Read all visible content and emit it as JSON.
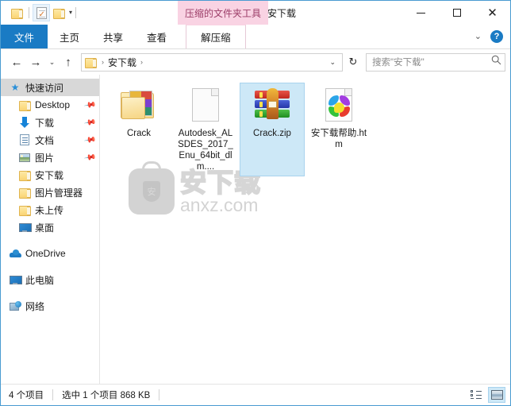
{
  "window": {
    "title": "安下载",
    "contextual_tab": "压缩的文件夹工具",
    "controls": {
      "minimize": "minimize-icon",
      "maximize": "maximize-icon",
      "close": "✕"
    }
  },
  "quick_access_toolbar": {
    "items": [
      {
        "name": "folder-properties-icon"
      },
      {
        "name": "document-check-icon"
      },
      {
        "name": "new-folder-icon"
      }
    ],
    "customize_caret": "▾"
  },
  "ribbon": {
    "tabs": [
      {
        "label": "文件",
        "selected": true
      },
      {
        "label": "主页",
        "selected": false
      },
      {
        "label": "共享",
        "selected": false
      },
      {
        "label": "查看",
        "selected": false
      }
    ],
    "contextual_tab": {
      "label": "解压缩"
    },
    "collapse_caret": "⌄",
    "help_label": "?"
  },
  "navbar": {
    "back": "←",
    "forward": "→",
    "recent_caret": "⌄",
    "up": "↑",
    "breadcrumb": {
      "root_icon": "folder-icon",
      "path": "安下载",
      "separator": "›"
    },
    "history_caret": "⌄",
    "refresh": "↻",
    "search": {
      "placeholder": "搜索\"安下载\"",
      "icon": "search-icon"
    }
  },
  "sidebar": {
    "items": [
      {
        "label": "快速访问",
        "icon": "star-icon",
        "selected": true,
        "pinned": false,
        "indent": 0
      },
      {
        "label": "Desktop",
        "icon": "folder-icon",
        "selected": false,
        "pinned": true,
        "indent": 1
      },
      {
        "label": "下载",
        "icon": "download-icon",
        "selected": false,
        "pinned": true,
        "indent": 1
      },
      {
        "label": "文档",
        "icon": "document-icon",
        "selected": false,
        "pinned": true,
        "indent": 1
      },
      {
        "label": "图片",
        "icon": "pictures-icon",
        "selected": false,
        "pinned": true,
        "indent": 1
      },
      {
        "label": "安下载",
        "icon": "folder-icon",
        "selected": false,
        "pinned": false,
        "indent": 1
      },
      {
        "label": "图片管理器",
        "icon": "folder-icon",
        "selected": false,
        "pinned": false,
        "indent": 1
      },
      {
        "label": "未上传",
        "icon": "folder-icon",
        "selected": false,
        "pinned": false,
        "indent": 1
      },
      {
        "label": "桌面",
        "icon": "desktop-icon",
        "selected": false,
        "pinned": false,
        "indent": 1
      },
      {
        "label": "OneDrive",
        "icon": "cloud-icon",
        "selected": false,
        "pinned": false,
        "indent": 0
      },
      {
        "label": "此电脑",
        "icon": "computer-icon",
        "selected": false,
        "pinned": false,
        "indent": 0
      },
      {
        "label": "网络",
        "icon": "network-icon",
        "selected": false,
        "pinned": false,
        "indent": 0
      }
    ]
  },
  "files": [
    {
      "name": "Crack",
      "icon": "folder-with-contents-icon",
      "selected": false
    },
    {
      "name": "Autodesk_ALSDES_2017_Enu_64bit_dlm....",
      "icon": "generic-file-icon",
      "selected": false
    },
    {
      "name": "Crack.zip",
      "icon": "winrar-archive-icon",
      "selected": true
    },
    {
      "name": "安下载帮助.htm",
      "icon": "html-chrome-icon",
      "selected": false
    }
  ],
  "watermark": {
    "shield_char": "安",
    "cn_text": "安下载",
    "en_text": "anxz.com"
  },
  "statusbar": {
    "item_count": "4 个项目",
    "selection": "选中 1 个项目  868 KB",
    "views": [
      {
        "name": "details-view-button",
        "active": false
      },
      {
        "name": "large-icons-view-button",
        "active": true
      }
    ]
  },
  "colors": {
    "accent": "#1a7bc4",
    "contextual_tab_bg": "#f9d3e3",
    "selection_bg": "#cde8f7",
    "window_border": "#4a9bd1"
  }
}
